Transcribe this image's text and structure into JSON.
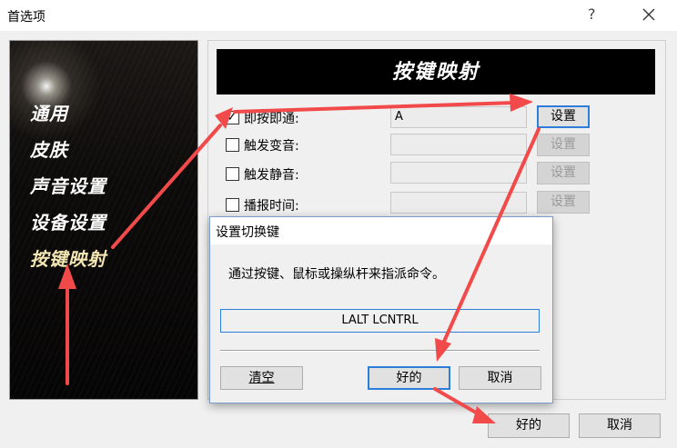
{
  "window": {
    "title": "首选项",
    "help_glyph": "?",
    "close_icon": "close-icon"
  },
  "sidebar": {
    "items": [
      {
        "label": "通用",
        "active": false
      },
      {
        "label": "皮肤",
        "active": false
      },
      {
        "label": "声音设置",
        "active": false
      },
      {
        "label": "设备设置",
        "active": false
      },
      {
        "label": "按键映射",
        "active": true
      }
    ]
  },
  "panel": {
    "header": "按键映射",
    "options": [
      {
        "label": "即按即通:",
        "checked": true,
        "value": "A",
        "button": "设置",
        "button_enabled": true
      },
      {
        "label": "触发变音:",
        "checked": false,
        "value": "",
        "button": "设置",
        "button_enabled": false
      },
      {
        "label": "触发静音:",
        "checked": false,
        "value": "",
        "button": "设置",
        "button_enabled": false
      },
      {
        "label": "播报时间:",
        "checked": false,
        "value": "",
        "button": "设置",
        "button_enabled": false
      }
    ]
  },
  "buttons": {
    "ok": "好的",
    "cancel": "取消"
  },
  "dialog": {
    "title": "设置切换键",
    "prompt": "通过按键、鼠标或操纵杆来指派命令。",
    "keys": "LALT LCNTRL",
    "clear": "清空",
    "ok": "好的",
    "cancel": "取消"
  },
  "colors": {
    "annotation_arrow": "#f24a4a",
    "focus_border": "#2d7ed8",
    "header_bg": "#000000"
  }
}
